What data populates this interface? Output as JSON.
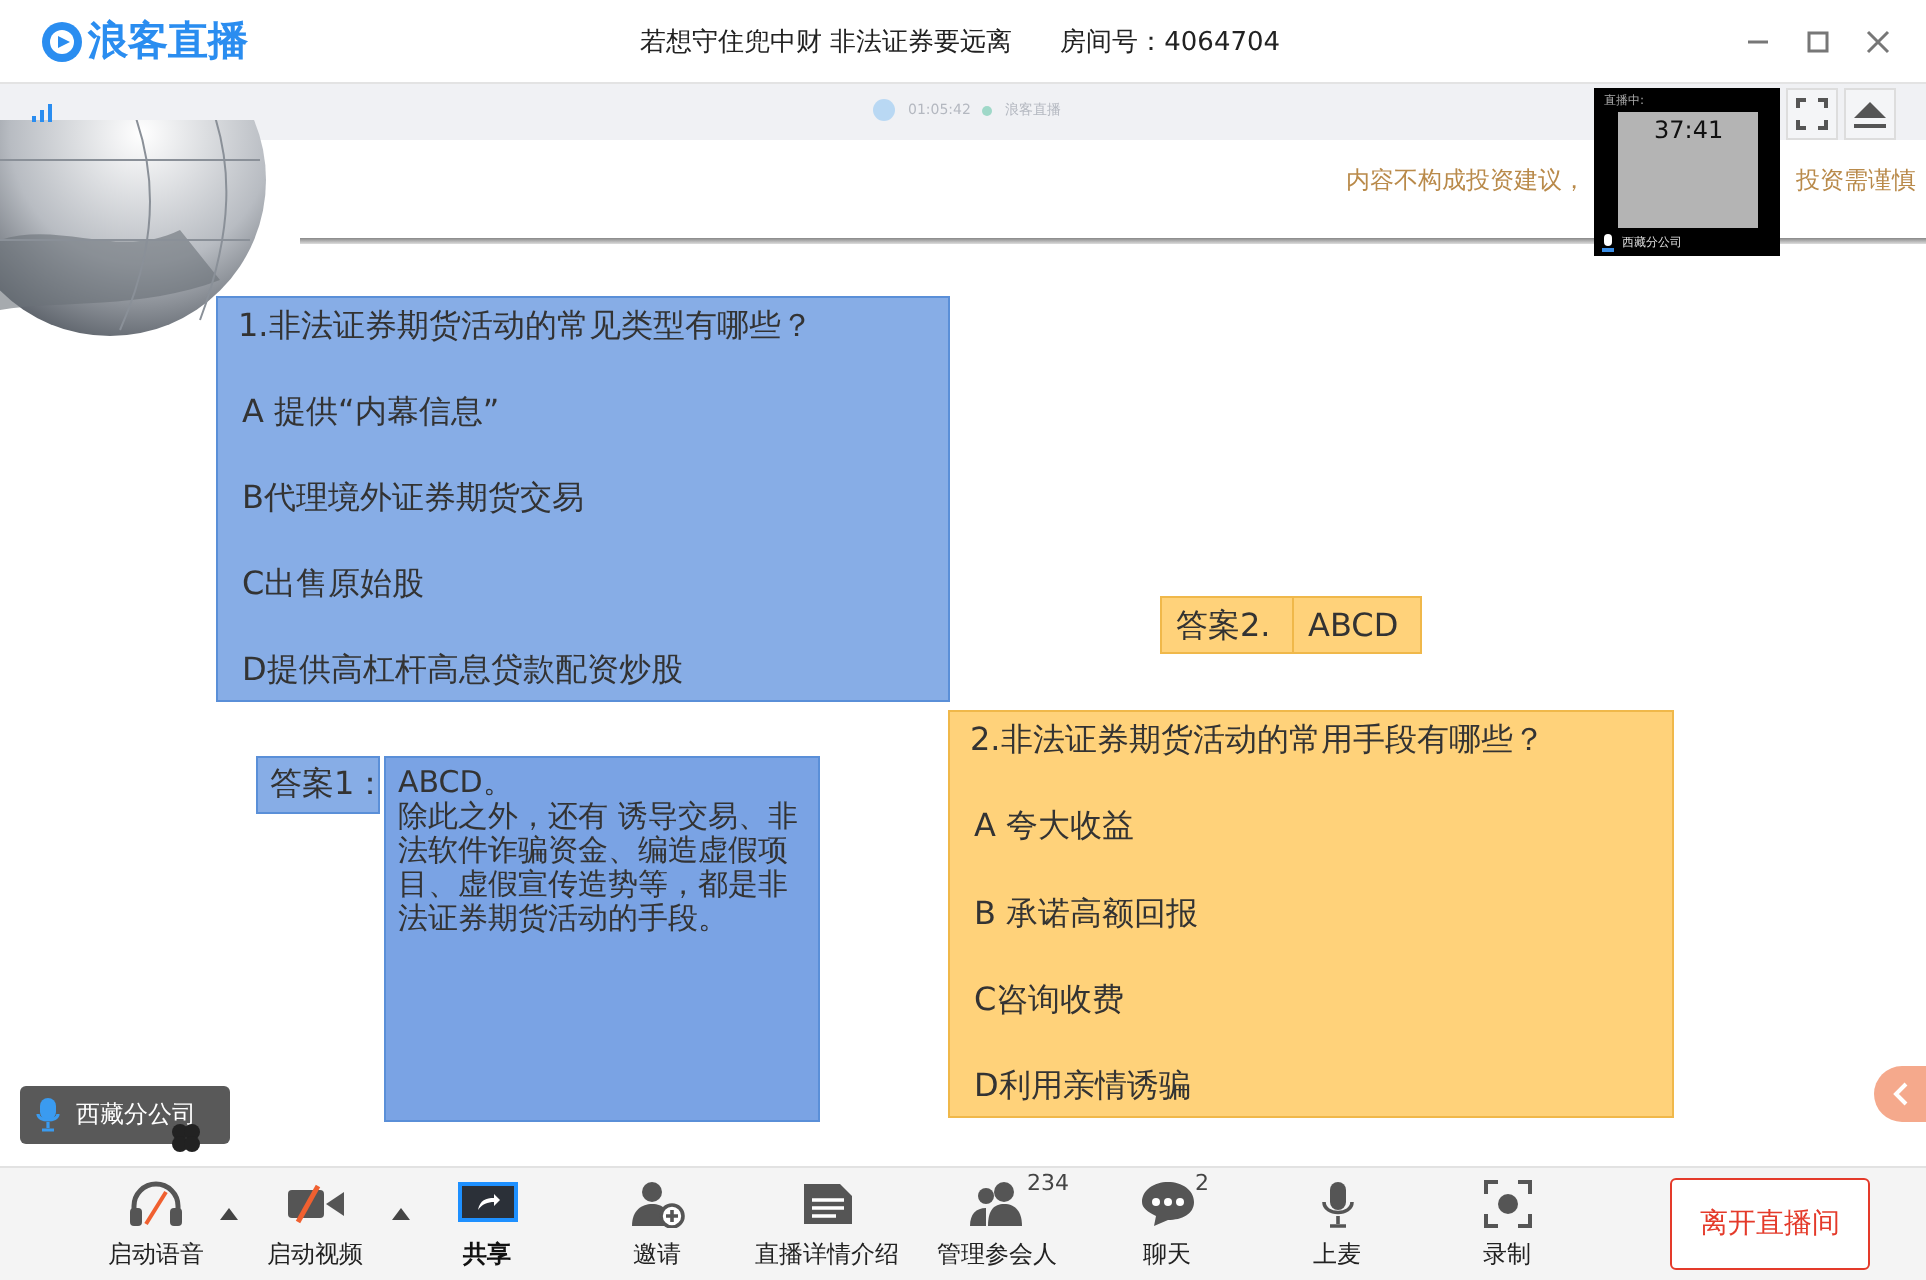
{
  "app": {
    "logo": "浪客直播"
  },
  "window": {
    "title": "若想守住兜中财 非法证券要远离",
    "room": "房间号：4064704"
  },
  "stream_bar": {
    "time": "01:05:42",
    "brand": "浪客直播"
  },
  "preview": {
    "status": "直播中:",
    "timer": "37:41",
    "speaker": "西藏分公司"
  },
  "slide": {
    "disclaimer": [
      "内容不构成投资建议，",
      "投资需谨慎"
    ],
    "question_1": {
      "title": "1.非法证券期货活动的常见类型有哪些？",
      "options": [
        "A 提供“内幕信息”",
        "B代理境外证券期货交易",
        "C出售原始股",
        "D提供高杠杆高息贷款配资炒股"
      ]
    },
    "answer_1": {
      "label": "答案1：",
      "lines": [
        "ABCD。",
        "除此之外，还有 诱导交易、非法软件诈骗资金、编造虚假项目、虚假宣传造势等，都是非法证券期货活动的手段。"
      ]
    },
    "answer_2": {
      "label": "答案2.",
      "text": "ABCD"
    },
    "question_2": {
      "title": "2.非法证券期货活动的常用手段有哪些？",
      "options": [
        "A 夸大收益",
        "B 承诺高额回报",
        "C咨询收费",
        "D利用亲情诱骗"
      ]
    }
  },
  "speaker_badge": {
    "name": "西藏分公司"
  },
  "toolbar": [
    {
      "kind": "voice",
      "label": "启动语音",
      "selected": false
    },
    {
      "kind": "caret"
    },
    {
      "kind": "video",
      "label": "启动视频",
      "selected": false
    },
    {
      "kind": "caret"
    },
    {
      "kind": "share",
      "label": "共享",
      "selected": true
    },
    {
      "kind": "invite",
      "label": "邀请",
      "selected": false
    },
    {
      "kind": "details",
      "label": "直播详情介绍",
      "selected": false
    },
    {
      "kind": "members",
      "label": "管理参会人",
      "count": "234",
      "selected": false
    },
    {
      "kind": "chat",
      "label": "聊天",
      "count": "2",
      "selected": false
    },
    {
      "kind": "mic",
      "label": "上麦",
      "selected": false
    },
    {
      "kind": "record",
      "label": "录制",
      "selected": false
    }
  ],
  "leave_button": "离开直播间"
}
